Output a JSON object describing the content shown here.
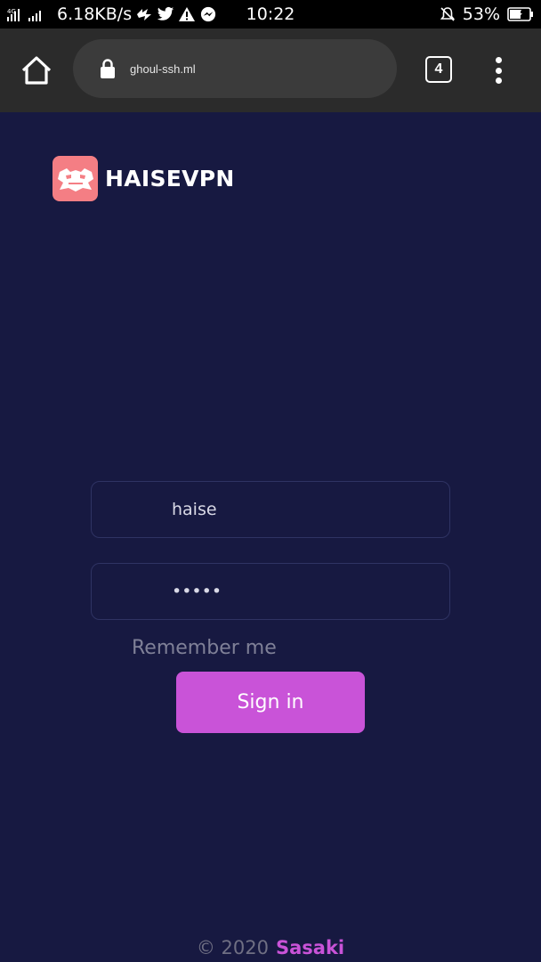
{
  "status_bar": {
    "network": "4G",
    "speed": "6.18KB/s",
    "time": "10:22",
    "battery": "53%",
    "icons": [
      "signal-icon",
      "twitter-icon",
      "warning-icon",
      "messenger-icon",
      "mute-bell-icon",
      "battery-icon"
    ]
  },
  "browser": {
    "url": "ghoul-ssh.ml",
    "tab_count": "4"
  },
  "brand": {
    "name": "HAISEVPN",
    "logo_color": "#f47e84"
  },
  "login": {
    "username_value": "haise",
    "password_value": "•••••",
    "remember_label": "Remember me",
    "signin_label": "Sign in"
  },
  "footer": {
    "copyright": "© 2020",
    "author": "Sasaki"
  },
  "colors": {
    "background": "#171941",
    "accent": "#c953d8"
  }
}
